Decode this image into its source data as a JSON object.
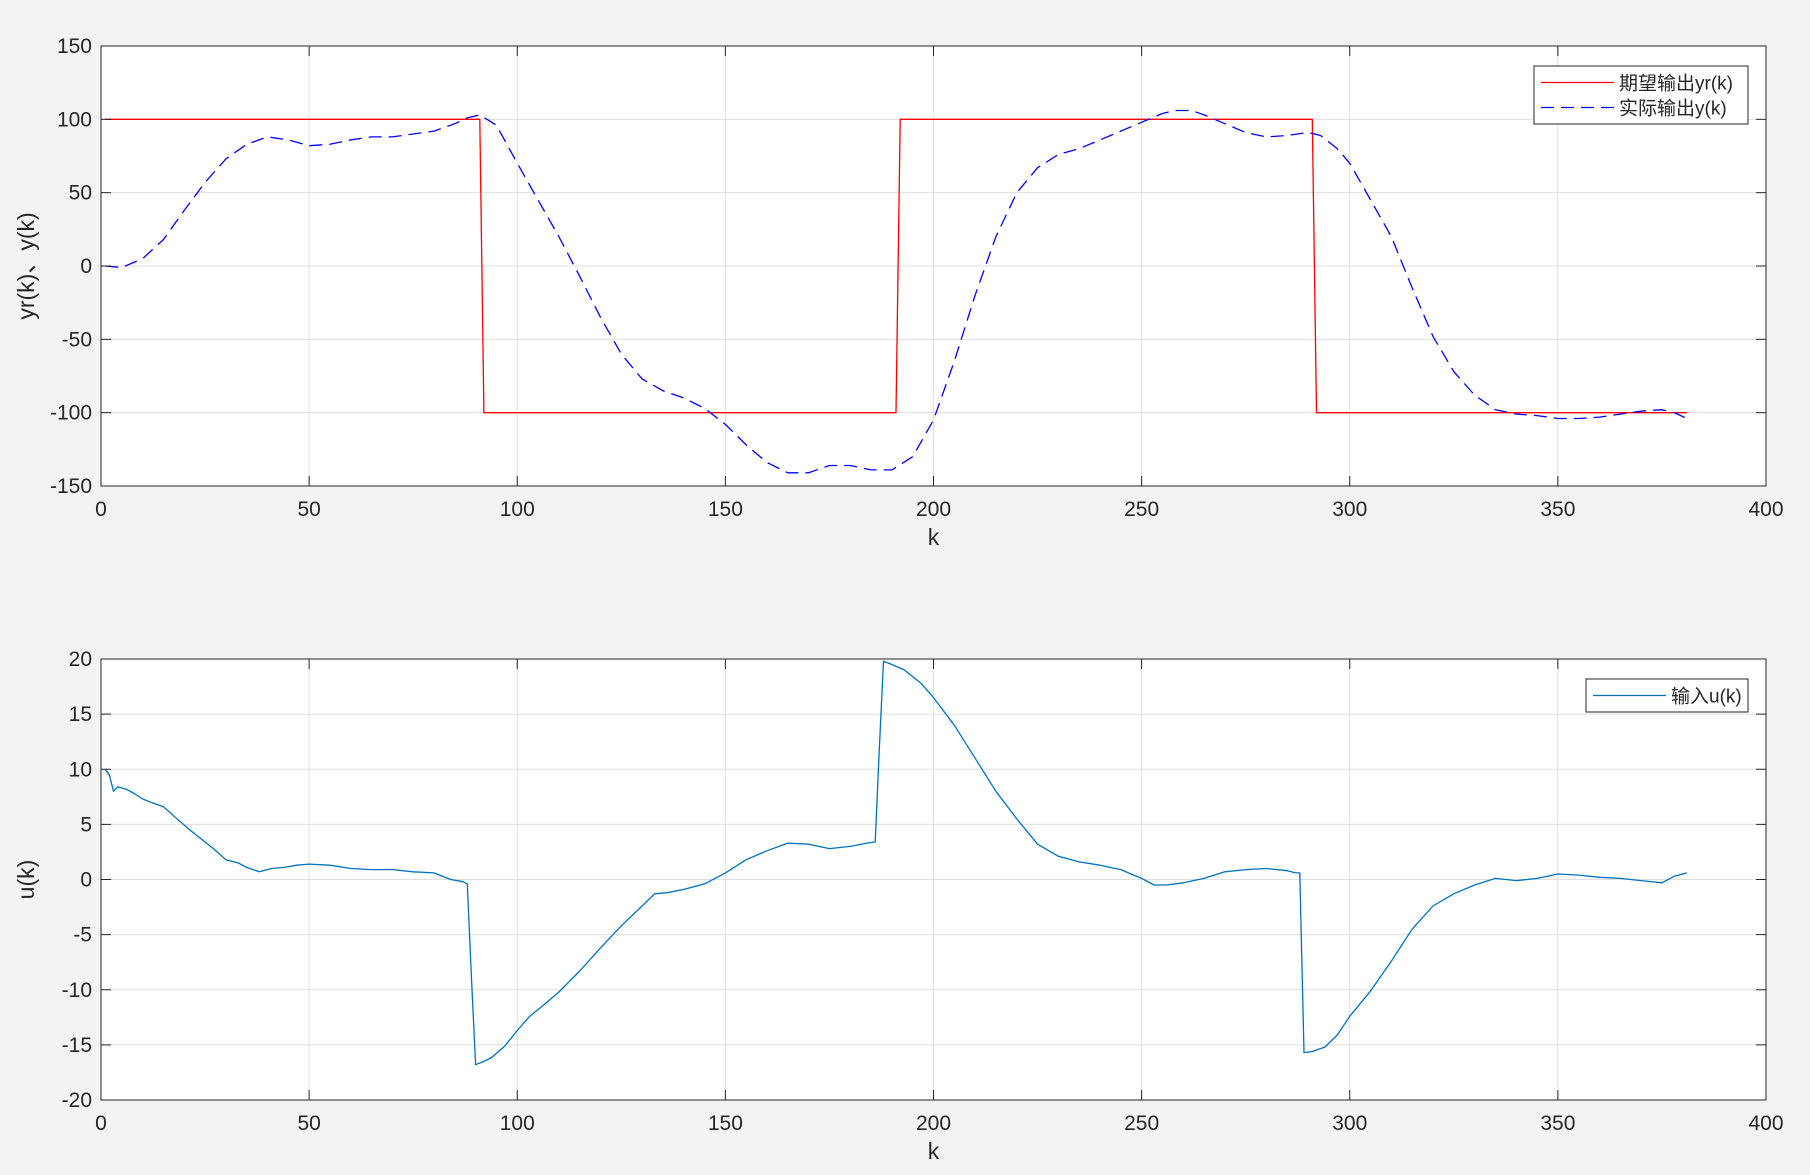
{
  "figure": {
    "background": "#f3f3f3",
    "axes_background": "#ffffff",
    "grid_color": "#dfdfdf",
    "axis_color": "#262626"
  },
  "chart_data": [
    {
      "type": "line",
      "xlabel": "k",
      "ylabel": "yr(k)、y(k)",
      "xlim": [
        0,
        400
      ],
      "ylim": [
        -150,
        150
      ],
      "xticks": [
        0,
        50,
        100,
        150,
        200,
        250,
        300,
        350,
        400
      ],
      "yticks": [
        -150,
        -100,
        -50,
        0,
        50,
        100,
        150
      ],
      "grid": true,
      "legend_position": "top-right",
      "series": [
        {
          "name": "期望输出yr(k)",
          "color": "#ff0000",
          "dash": "solid",
          "x": [
            1,
            91,
            92,
            191,
            192,
            291,
            292,
            381
          ],
          "y": [
            100,
            100,
            -100,
            -100,
            100,
            100,
            -100,
            -100
          ]
        },
        {
          "name": "实际输出y(k)",
          "color": "#0000ff",
          "dash": "dashed",
          "x": [
            1,
            5,
            10,
            15,
            20,
            25,
            30,
            35,
            40,
            45,
            50,
            55,
            60,
            65,
            70,
            75,
            80,
            85,
            88,
            91,
            95,
            100,
            105,
            110,
            115,
            120,
            125,
            130,
            135,
            140,
            145,
            150,
            155,
            160,
            165,
            170,
            175,
            180,
            185,
            190,
            195,
            200,
            205,
            210,
            215,
            220,
            225,
            230,
            235,
            240,
            245,
            250,
            255,
            258,
            262,
            265,
            270,
            275,
            280,
            285,
            290,
            293,
            297,
            300,
            305,
            310,
            315,
            320,
            325,
            330,
            335,
            340,
            345,
            350,
            355,
            360,
            365,
            370,
            375,
            378,
            381
          ],
          "y": [
            0,
            -1,
            5,
            18,
            38,
            57,
            73,
            83,
            88,
            86,
            82,
            83,
            86,
            88,
            88,
            90,
            92,
            97,
            101,
            103,
            96,
            70,
            45,
            20,
            -7,
            -35,
            -60,
            -77,
            -85,
            -90,
            -97,
            -108,
            -122,
            -134,
            -141,
            -141,
            -136,
            -136,
            -139,
            -139,
            -130,
            -105,
            -65,
            -20,
            20,
            50,
            67,
            76,
            80,
            86,
            92,
            98,
            104,
            106,
            106,
            103,
            97,
            91,
            88,
            89,
            91,
            89,
            80,
            70,
            45,
            20,
            -15,
            -48,
            -72,
            -88,
            -98,
            -101,
            -102,
            -104,
            -104,
            -103,
            -101,
            -99,
            -98,
            -100,
            -104
          ]
        }
      ]
    },
    {
      "type": "line",
      "xlabel": "k",
      "ylabel": "u(k)",
      "xlim": [
        0,
        400
      ],
      "ylim": [
        -20,
        20
      ],
      "xticks": [
        0,
        50,
        100,
        150,
        200,
        250,
        300,
        350,
        400
      ],
      "yticks": [
        -20,
        -15,
        -10,
        -5,
        0,
        5,
        10,
        15,
        20
      ],
      "grid": true,
      "legend_position": "top-right",
      "series": [
        {
          "name": "输入u(k)",
          "color": "#0072bd",
          "dash": "solid",
          "x": [
            1,
            2,
            3,
            4,
            6,
            8,
            10,
            12,
            15,
            18,
            21,
            24,
            27,
            30,
            33,
            35,
            38,
            41,
            44,
            47,
            50,
            55,
            60,
            65,
            70,
            75,
            80,
            84,
            87,
            88,
            89,
            90,
            92,
            94,
            97,
            100,
            103,
            106,
            110,
            115,
            120,
            125,
            130,
            133,
            136,
            140,
            145,
            150,
            155,
            160,
            165,
            170,
            175,
            180,
            184,
            186,
            187,
            188,
            190,
            193,
            197,
            200,
            205,
            210,
            215,
            220,
            225,
            230,
            235,
            240,
            245,
            250,
            253,
            256,
            260,
            265,
            270,
            275,
            280,
            285,
            287,
            288,
            289,
            291,
            294,
            297,
            300,
            305,
            310,
            315,
            320,
            325,
            330,
            335,
            340,
            345,
            350,
            355,
            360,
            365,
            370,
            375,
            378,
            381
          ],
          "y": [
            10,
            9.5,
            8,
            8.4,
            8.2,
            7.8,
            7.3,
            7,
            6.6,
            5.6,
            4.6,
            3.7,
            2.8,
            1.8,
            1.5,
            1.1,
            0.7,
            1,
            1.1,
            1.3,
            1.4,
            1.3,
            1.0,
            0.9,
            0.9,
            0.7,
            0.6,
            0,
            -0.2,
            -0.4,
            -9,
            -16.8,
            -16.5,
            -16.1,
            -15.1,
            -13.7,
            -12.4,
            -11.5,
            -10.2,
            -8.3,
            -6.2,
            -4.2,
            -2.4,
            -1.3,
            -1.2,
            -0.9,
            -0.4,
            0.6,
            1.8,
            2.6,
            3.3,
            3.2,
            2.8,
            3.0,
            3.3,
            3.4,
            12,
            19.8,
            19.5,
            19.0,
            17.8,
            16.5,
            14.0,
            11.0,
            8.0,
            5.5,
            3.2,
            2.1,
            1.6,
            1.3,
            0.9,
            0.1,
            -0.5,
            -0.5,
            -0.3,
            0.1,
            0.7,
            0.9,
            1.0,
            0.8,
            0.6,
            0.6,
            -15.7,
            -15.6,
            -15.2,
            -14.1,
            -12.4,
            -10.1,
            -7.4,
            -4.5,
            -2.4,
            -1.3,
            -0.5,
            0.1,
            -0.1,
            0.1,
            0.5,
            0.4,
            0.2,
            0.1,
            -0.1,
            -0.3,
            0.3,
            0.6
          ]
        }
      ]
    }
  ]
}
